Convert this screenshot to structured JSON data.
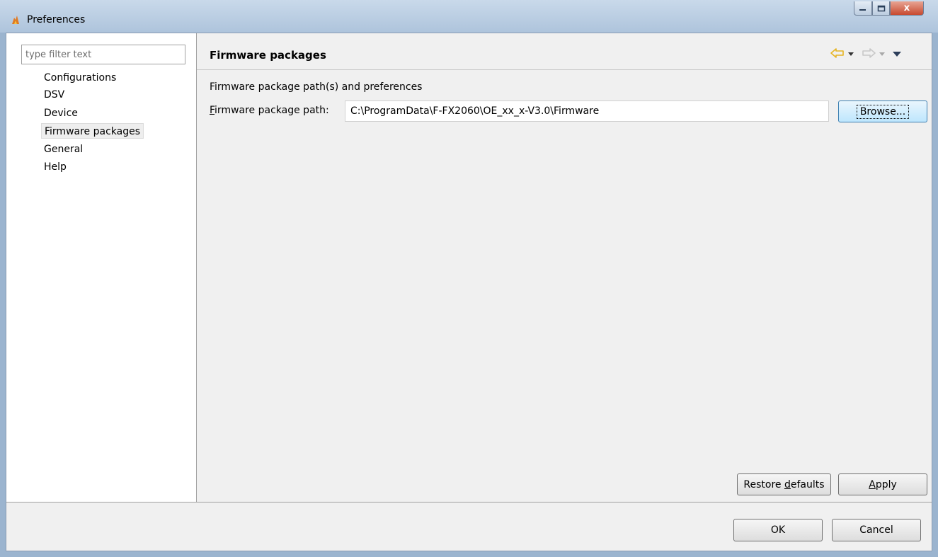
{
  "window": {
    "title": "Preferences",
    "controls": {
      "minimize": "—",
      "maximize": "□",
      "close": "x"
    }
  },
  "sidebar": {
    "filter_placeholder": "type filter text",
    "items": [
      {
        "label": "Configurations",
        "selected": false
      },
      {
        "label": "DSV",
        "selected": false
      },
      {
        "label": "Device",
        "selected": false
      },
      {
        "label": "Firmware packages",
        "selected": true
      },
      {
        "label": "General",
        "selected": false
      },
      {
        "label": "Help",
        "selected": false
      }
    ]
  },
  "page": {
    "title": "Firmware packages",
    "nav": {
      "back_icon": "back-arrow-icon",
      "forward_icon": "forward-arrow-icon",
      "menu_icon": "view-menu-icon"
    },
    "section_label": "Firmware package path(s) and preferences",
    "path_label_mnemonic": "F",
    "path_label_rest": "irmware package path:",
    "path_value": "C:\\ProgramData\\F-FX2060\\OE_xx_x-V3.0\\Firmware",
    "browse_label": "Browse...",
    "restore_label_prefix": "Restore ",
    "restore_label_mnemonic": "d",
    "restore_label_suffix": "efaults",
    "apply_label_mnemonic": "A",
    "apply_label_rest": "pply"
  },
  "footer": {
    "ok_label": "OK",
    "cancel_label": "Cancel"
  },
  "colors": {
    "title_gradient_top": "#c9d9ea",
    "close_button": "#c74a30",
    "arrow_gold": "#e6b422",
    "arrow_disabled": "#c8c8c8"
  }
}
